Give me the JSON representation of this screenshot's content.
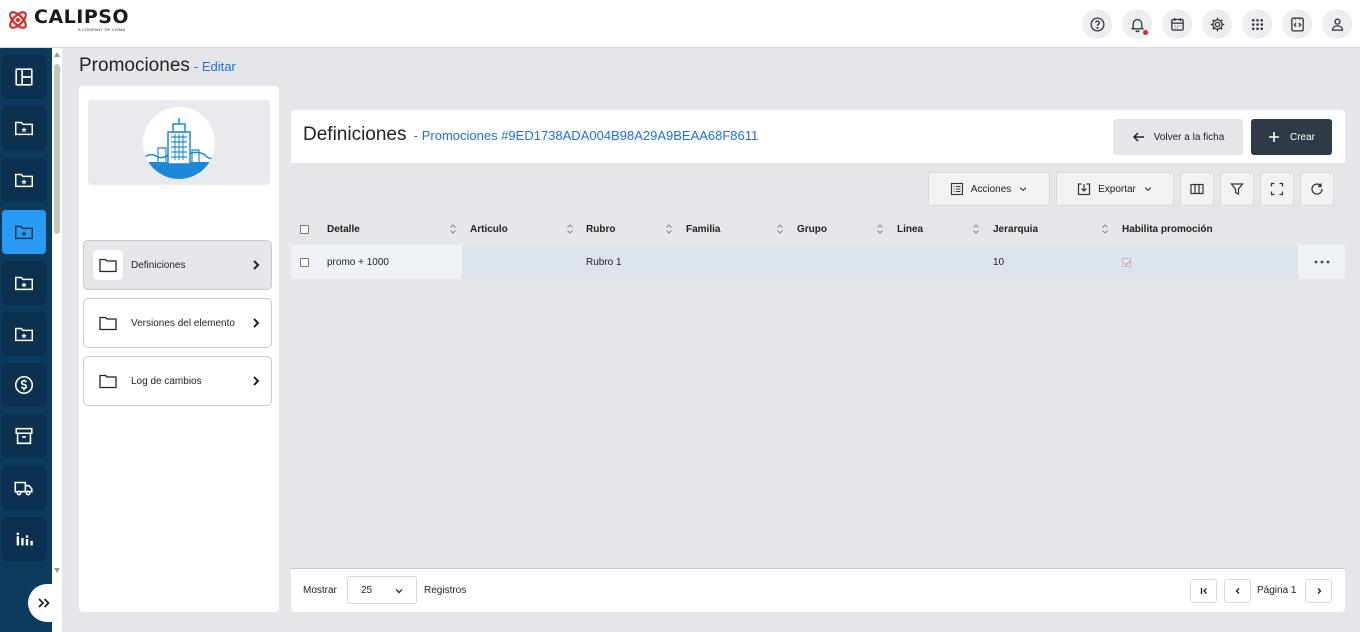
{
  "brand": {
    "name": "CALIPSO",
    "tagline": "A COMPANY OF VISMA"
  },
  "topbar_icons": [
    "help-icon",
    "bell-icon",
    "calendar-icon",
    "gear-icon",
    "apps-grid-icon",
    "code-file-icon",
    "user-icon"
  ],
  "sidebar_icons": [
    "dashboard-icon",
    "folder-star-icon",
    "folder-star-icon",
    "folder-star-icon",
    "folder-star-icon",
    "folder-star-icon",
    "dollar-icon",
    "archive-icon",
    "truck-icon",
    "bar-chart-icon"
  ],
  "sidebar_active_index": 3,
  "page": {
    "title": "Promociones",
    "subtitle": "- Editar"
  },
  "left_nav": [
    {
      "label": "Definiciones",
      "active": true
    },
    {
      "label": "Versiones del elemento",
      "active": false
    },
    {
      "label": "Log de cambios",
      "active": false
    }
  ],
  "main": {
    "title": "Definiciones",
    "subtitle": "- Promociones #9ED1738ADA004B98A29A9BEAA68F8611",
    "volver_label": "Volver a la ficha",
    "crear_label": "Crear",
    "toolbar": {
      "acciones_label": "Acciones",
      "exportar_label": "Exportar"
    }
  },
  "table": {
    "columns": [
      "Detalle",
      "Articulo",
      "Rubro",
      "Familia",
      "Grupo",
      "Linea",
      "Jerarquia",
      "Habilita promoción"
    ],
    "rows": [
      {
        "detalle": "promo + 1000",
        "articulo": "",
        "rubro": "Rubro 1",
        "familia": "",
        "grupo": "",
        "linea": "",
        "jerarquia": "10",
        "habilita": true
      }
    ]
  },
  "footer": {
    "mostrar_label": "Mostrar",
    "page_size": "25",
    "registros_label": "Registros",
    "page_label": "Página 1"
  },
  "colors": {
    "sidebar": "#0d3b5e",
    "sidebar_active": "#2b9af3",
    "link": "#1e6fd9",
    "primary_button": "#2f3a46",
    "notification": "#d32f2f"
  }
}
